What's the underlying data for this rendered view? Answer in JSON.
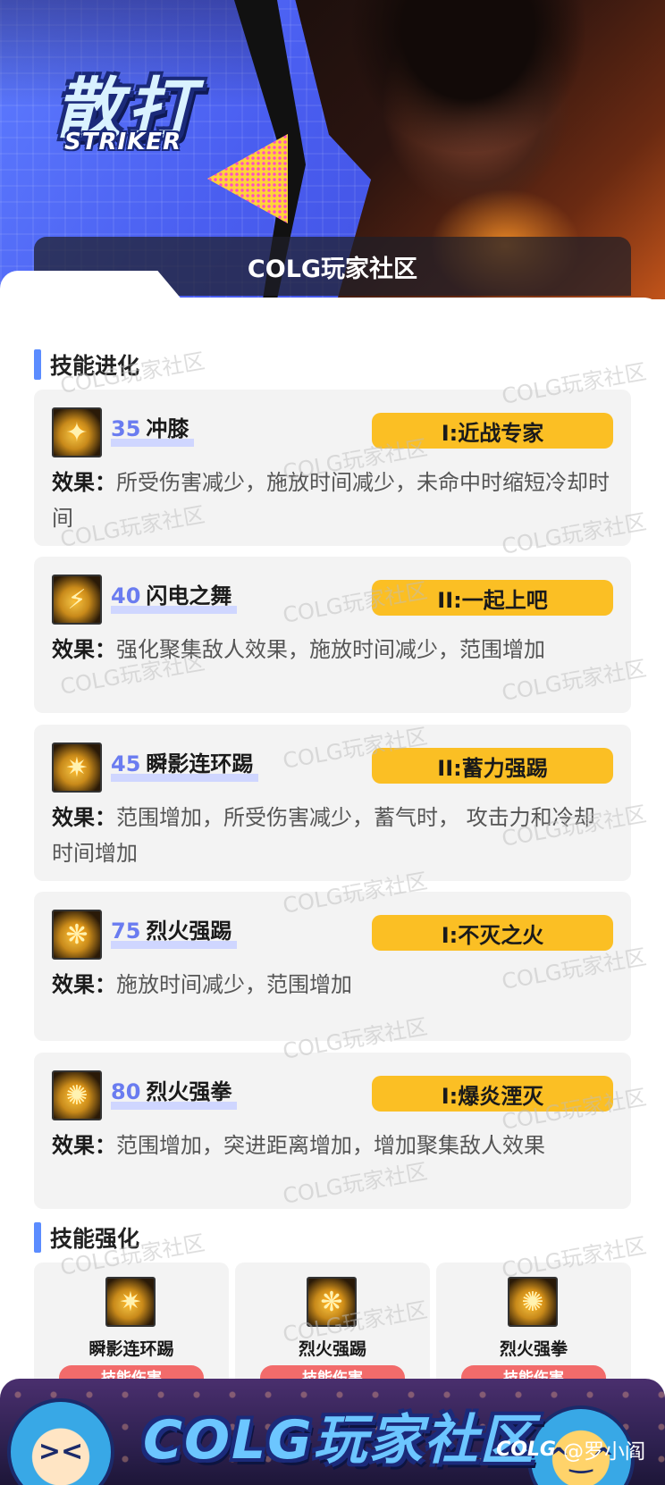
{
  "hero": {
    "title": "散打",
    "subtitle": "STRIKER",
    "community": "COLG玩家社区"
  },
  "watermark": "COLG玩家社区",
  "evolution": {
    "section_title": "技能进化",
    "effect_label": "效果：",
    "items": [
      {
        "level": "35",
        "name": "冲膝",
        "badge": "I:近战专家",
        "effect": "所受伤害减少，施放时间减少，未命中时缩短冷却时间",
        "icon": "knee-strike-icon"
      },
      {
        "level": "40",
        "name": "闪电之舞",
        "badge": "II:一起上吧",
        "effect": "强化聚集敌人效果，施放时间减少，范围增加",
        "icon": "lightning-dance-icon"
      },
      {
        "level": "45",
        "name": "瞬影连环踢",
        "badge": "II:蓄力强踢",
        "effect": "范围增加，所受伤害减少，蓄气时， 攻击力和冷却时间增加",
        "icon": "shadow-kick-icon"
      },
      {
        "level": "75",
        "name": "烈火强踢",
        "badge": "I:不灭之火",
        "effect": "施放时间减少，范围增加",
        "icon": "flame-kick-icon"
      },
      {
        "level": "80",
        "name": "烈火强拳",
        "badge": "I:爆炎湮灭",
        "effect": "范围增加，突进距离增加，增加聚集敌人效果",
        "icon": "flame-fist-icon"
      }
    ]
  },
  "enhancement": {
    "section_title": "技能强化",
    "items": [
      {
        "name": "瞬影连环踢",
        "tag": "技能伤害",
        "icon": "shadow-kick-icon"
      },
      {
        "name": "烈火强踢",
        "tag": "技能伤害",
        "icon": "flame-kick-icon"
      },
      {
        "name": "烈火强拳",
        "tag": "技能伤害",
        "icon": "flame-fist-icon"
      }
    ]
  },
  "footer": {
    "title": "COLG玩家社区",
    "brand": "COLG",
    "author": "@罗小阎"
  }
}
